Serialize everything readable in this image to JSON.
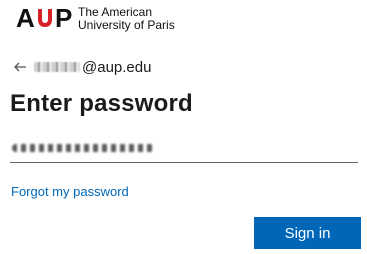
{
  "logo": {
    "letters_a": "A",
    "letters_p": "P",
    "line1": "The American",
    "line2": "University of Paris",
    "brand_color": "#d61f26"
  },
  "identity": {
    "email_visible": "@aup.edu",
    "back_icon": "left-arrow-icon"
  },
  "title": "Enter password",
  "password": {
    "masked": true
  },
  "links": {
    "forgot": "Forgot my password"
  },
  "buttons": {
    "sign_in": "Sign in",
    "accent": "#0067b8"
  }
}
